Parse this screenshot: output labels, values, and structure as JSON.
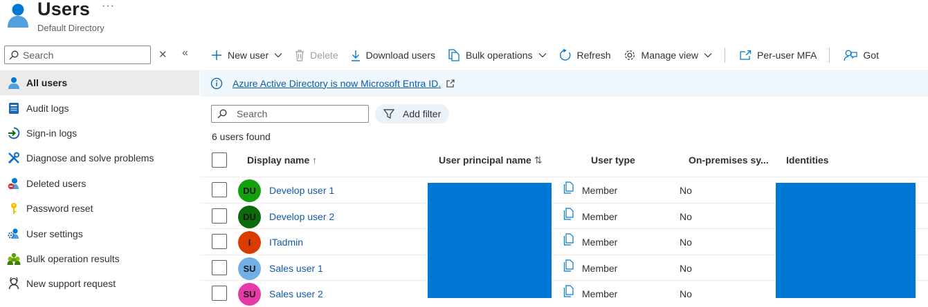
{
  "header": {
    "title": "Users",
    "more": "···",
    "subtitle": "Default Directory"
  },
  "sidebar": {
    "search_placeholder": "Search",
    "items": [
      {
        "label": "All users",
        "icon": "user-icon",
        "active": true
      },
      {
        "label": "Audit logs",
        "icon": "audit-log-icon"
      },
      {
        "label": "Sign-in logs",
        "icon": "sign-in-icon"
      },
      {
        "label": "Diagnose and solve problems",
        "icon": "wrench-icon"
      },
      {
        "label": "Deleted users",
        "icon": "deleted-user-icon"
      },
      {
        "label": "Password reset",
        "icon": "key-icon"
      },
      {
        "label": "User settings",
        "icon": "user-settings-icon"
      },
      {
        "label": "Bulk operation results",
        "icon": "bulk-results-icon"
      },
      {
        "label": "New support request",
        "icon": "support-icon"
      }
    ]
  },
  "toolbar": {
    "new_user": "New user",
    "delete": "Delete",
    "download_users": "Download users",
    "bulk_operations": "Bulk operations",
    "refresh": "Refresh",
    "manage_view": "Manage view",
    "per_user_mfa": "Per-user MFA",
    "got_feedback": "Got"
  },
  "banner": {
    "text": "Azure Active Directory is now Microsoft Entra ID."
  },
  "filter": {
    "search_placeholder": "Search",
    "add_filter": "Add filter",
    "count": "6 users found"
  },
  "table": {
    "columns": {
      "display_name": "Display name",
      "display_name_sort": "↑",
      "upn": "User principal name",
      "upn_sort": "⇅",
      "user_type": "User type",
      "on_prem": "On-premises sy...",
      "identities": "Identities"
    },
    "rows": [
      {
        "initials": "DU",
        "avatar_color": "#13a10e",
        "name": "Develop user 1",
        "type": "Member",
        "on_prem": "No"
      },
      {
        "initials": "DU",
        "avatar_color": "#0b6a0b",
        "name": "Develop user 2",
        "type": "Member",
        "on_prem": "No"
      },
      {
        "initials": "I",
        "avatar_color": "#da3b01",
        "name": "ITadmin",
        "type": "Member",
        "on_prem": "No"
      },
      {
        "initials": "SU",
        "avatar_color": "#71afe5",
        "name": "Sales user 1",
        "type": "Member",
        "on_prem": "No"
      },
      {
        "initials": "SU",
        "avatar_color": "#e43ba6",
        "name": "Sales user 2",
        "type": "Member",
        "on_prem": "No"
      }
    ]
  },
  "colors": {
    "accent": "#0078d4",
    "link": "#0f5ba7",
    "banner_bg": "#eff6fc",
    "nav_active": "#edebe9"
  }
}
